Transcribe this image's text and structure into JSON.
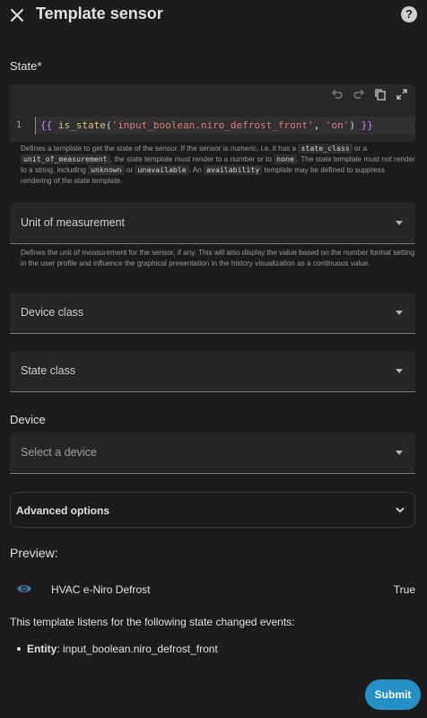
{
  "header": {
    "title": "Template sensor"
  },
  "state": {
    "label": "State*",
    "line_number": "1",
    "code": {
      "open": "{{",
      "fn": "is_state",
      "paren_open": "(",
      "arg1": "'input_boolean.niro_defrost_front'",
      "comma": ", ",
      "arg2": "'on'",
      "paren_close": ")",
      "close": "}}"
    },
    "help": {
      "t1": "Defines a template to get the state of the sensor. If the sensor is numeric, i.e. it has a ",
      "c1": "state_class",
      "t2": " or a ",
      "c2": "unit_of_measurement",
      "t3": ", the state template must render to a number or to ",
      "c3": "none",
      "t4": ". The state template must not render to a string, including ",
      "c4": "unknown",
      "t5": " or ",
      "c5": "unavailable",
      "t6": ". An ",
      "c6": "availability",
      "t7": " template may be defined to suppress rendering of the state template."
    }
  },
  "unit": {
    "label": "Unit of measurement",
    "help": "Defines the unit of measurement for the sensor, if any. This will also display the value based on the number format setting in the user profile and influence the graphical presentation in the history visualization as a continuous value."
  },
  "device_class": {
    "label": "Device class"
  },
  "state_class": {
    "label": "State class"
  },
  "device": {
    "label": "Device",
    "placeholder": "Select a device"
  },
  "advanced": {
    "label": "Advanced options"
  },
  "preview": {
    "label": "Preview:",
    "entity_name": "HVAC e-Niro Defrost",
    "entity_state": "True",
    "listen_text": "This template listens for the following state changed events:",
    "entity_label": "Entity",
    "entity_id": ": input_boolean.niro_defrost_front"
  },
  "submit_label": "Submit",
  "colors": {
    "background": "#1c1c1c",
    "accent": "#2390c6",
    "field": "#262626"
  }
}
